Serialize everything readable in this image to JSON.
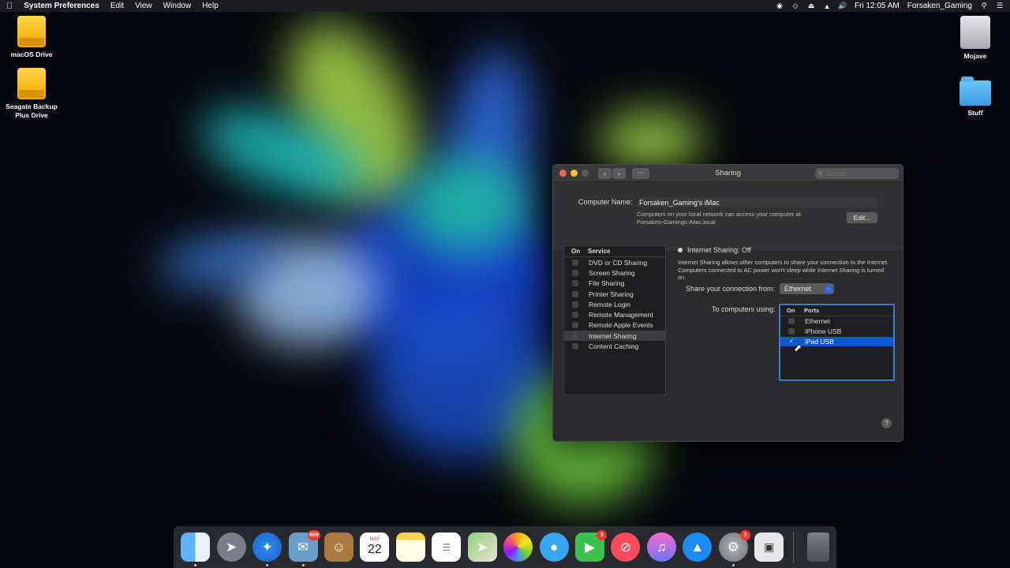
{
  "menubar": {
    "app_name": "System Preferences",
    "menus": [
      "Edit",
      "View",
      "Window",
      "Help"
    ],
    "time": "Fri 12:05 AM",
    "user": "Forsaken_Gaming"
  },
  "desktop": {
    "icons": [
      "macOS Drive",
      "Seagate Backup Plus Drive",
      "Mojave",
      "Stuff"
    ]
  },
  "window": {
    "title": "Sharing",
    "search_placeholder": "Search",
    "computer_name_label": "Computer Name:",
    "computer_name_value": "Forsaken_Gaming's iMac",
    "computer_name_desc_line1": "Computers on your local network can access your computer at:",
    "computer_name_desc_line2": "Forsaken-Gamings-iMac.local",
    "edit_button": "Edit...",
    "services_header": {
      "on": "On",
      "service": "Service"
    },
    "services": [
      "DVD or CD Sharing",
      "Screen Sharing",
      "File Sharing",
      "Printer Sharing",
      "Remote Login",
      "Remote Management",
      "Remote Apple Events",
      "Internet Sharing",
      "Content Caching"
    ],
    "selected_service": "Internet Sharing",
    "status": "Internet Sharing: Off",
    "status_desc": "Internet Sharing allows other computers to share your connection to the Internet. Computers connected to AC power won't sleep while Internet Sharing is turned on.",
    "share_from_label": "Share your connection from:",
    "share_from_value": "Ethernet",
    "to_computers_label": "To computers using:",
    "ports_header": {
      "on": "On",
      "ports": "Ports"
    },
    "ports": [
      {
        "name": "Ethernet",
        "checked": false
      },
      {
        "name": "iPhone USB",
        "checked": false
      },
      {
        "name": "iPad USB",
        "checked": true
      }
    ],
    "help": "?"
  },
  "dock": {
    "apps": [
      {
        "name": "finder",
        "badge": ""
      },
      {
        "name": "launchpad",
        "badge": ""
      },
      {
        "name": "safari",
        "badge": ""
      },
      {
        "name": "mail",
        "badge": "609"
      },
      {
        "name": "contacts",
        "badge": ""
      },
      {
        "name": "calendar",
        "badge": ""
      },
      {
        "name": "notes",
        "badge": ""
      },
      {
        "name": "reminders",
        "badge": ""
      },
      {
        "name": "maps",
        "badge": ""
      },
      {
        "name": "photos",
        "badge": ""
      },
      {
        "name": "messages",
        "badge": ""
      },
      {
        "name": "facetime",
        "badge": "3"
      },
      {
        "name": "news",
        "badge": ""
      },
      {
        "name": "itunes",
        "badge": ""
      },
      {
        "name": "app-store",
        "badge": ""
      },
      {
        "name": "system-preferences",
        "badge": "1"
      },
      {
        "name": "screenshot",
        "badge": ""
      }
    ],
    "calendar_month": "MAY",
    "calendar_day": "22"
  }
}
